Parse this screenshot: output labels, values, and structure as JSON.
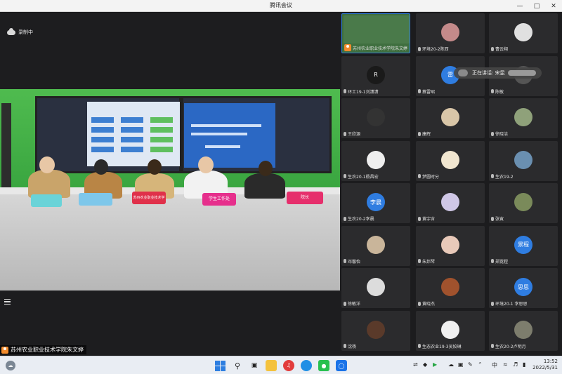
{
  "window": {
    "title": "腾讯会议",
    "controls": [
      "minimize",
      "maximize",
      "close"
    ]
  },
  "main": {
    "recording_label": "录制中",
    "presenter_name": "苏州农业职业技术学院朱文婷",
    "video_signs": [
      "苏州农业职业技术学院",
      "学生工作处",
      "院长"
    ]
  },
  "participants": [
    {
      "name": "苏州农业职业技术学院朱文婷",
      "avatar_text": "",
      "avatar_color": "#4a7a4a"
    },
    {
      "name": "环境20-2陈西",
      "avatar_text": "",
      "avatar_color": "#c48a8a"
    },
    {
      "name": "曹云翔",
      "avatar_text": "",
      "avatar_color": "#e0e0e0"
    },
    {
      "name": "环工19-1刘潇潇",
      "avatar_text": "R",
      "avatar_color": "#1a1a1a"
    },
    {
      "name": "蔡雷昭",
      "avatar_text": "雷",
      "avatar_color": "#2f7de1"
    },
    {
      "name": "陈敏",
      "avatar_text": "",
      "avatar_color": "#555555"
    },
    {
      "name": "王欣源",
      "avatar_text": "",
      "avatar_color": "#333333"
    },
    {
      "name": "康辉",
      "avatar_text": "",
      "avatar_color": "#d9c6a8"
    },
    {
      "name": "徐晓洁",
      "avatar_text": "",
      "avatar_color": "#8fa17a"
    },
    {
      "name": "生农20-1杨昌宏",
      "avatar_text": "",
      "avatar_color": "#eeeeee"
    },
    {
      "name": "梦圆时分",
      "avatar_text": "",
      "avatar_color": "#f1e6d0"
    },
    {
      "name": "生农19-2",
      "avatar_text": "",
      "avatar_color": "#6a8fb0"
    },
    {
      "name": "生农20-2李晨",
      "avatar_text": "李晨",
      "avatar_color": "#2f7de1"
    },
    {
      "name": "黄宇含",
      "avatar_text": "",
      "avatar_color": "#cfc7e6"
    },
    {
      "name": "张寅",
      "avatar_text": "",
      "avatar_color": "#7a8a5a"
    },
    {
      "name": "邓馨怡",
      "avatar_text": "",
      "avatar_color": "#c9b59a"
    },
    {
      "name": "朱邦琴",
      "avatar_text": "",
      "avatar_color": "#e8c9b9"
    },
    {
      "name": "郑霓程",
      "avatar_text": "景程",
      "avatar_color": "#2f7de1"
    },
    {
      "name": "徐敏洋",
      "avatar_text": "",
      "avatar_color": "#dcdcdc"
    },
    {
      "name": "黄晓杰",
      "avatar_text": "",
      "avatar_color": "#a0522d"
    },
    {
      "name": "环境20-1 李思思",
      "avatar_text": "思思",
      "avatar_color": "#2f7de1"
    },
    {
      "name": "沈杨",
      "avatar_text": "",
      "avatar_color": "#5a3a2a"
    },
    {
      "name": "生态农业19-3吴姣琳",
      "avatar_text": "",
      "avatar_color": "#f0f0f0"
    },
    {
      "name": "生农20-2卢明月",
      "avatar_text": "",
      "avatar_color": "#7d7d6d"
    }
  ],
  "speaking_tip": "正在讲话: 宋昆",
  "taskbar": {
    "tray_lang": "中",
    "time": "13:52",
    "date": "2022/5/31"
  }
}
